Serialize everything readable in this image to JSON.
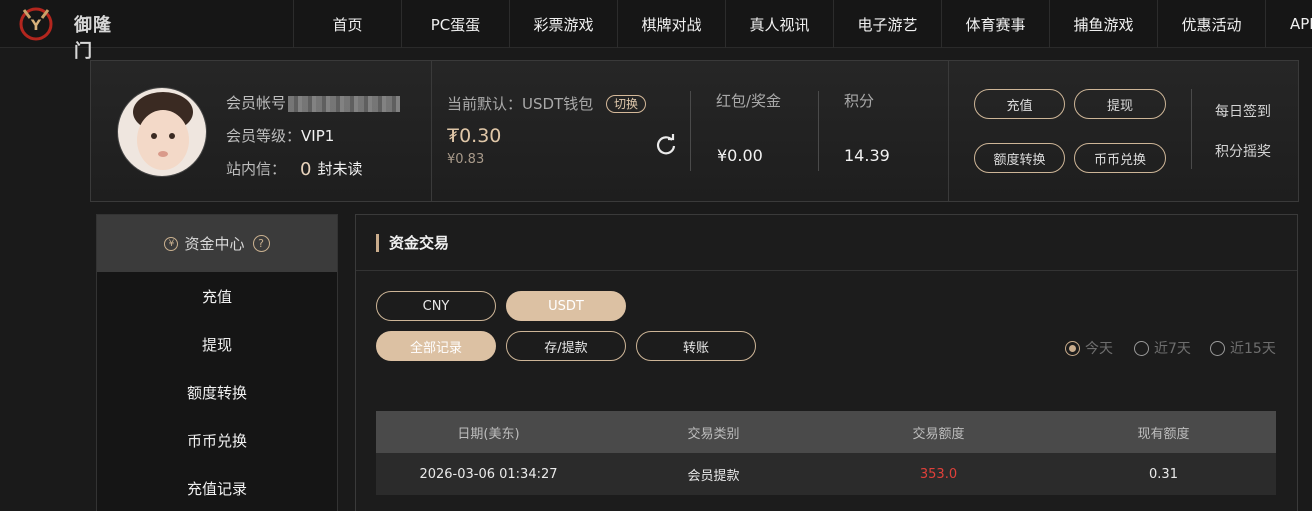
{
  "brand": {
    "name": "御隆门"
  },
  "nav": {
    "items": [
      "首页",
      "PC蛋蛋",
      "彩票游戏",
      "棋牌对战",
      "真人视讯",
      "电子游艺",
      "体育赛事",
      "捕鱼游戏",
      "优惠活动",
      "APP"
    ]
  },
  "member": {
    "account_label": "会员帐号",
    "level_label": "会员等级：",
    "level_value": "VIP1",
    "mail_label": "站内信：",
    "mail_count": "0",
    "mail_suffix": "封未读",
    "wallet_label": "当前默认：USDT钱包",
    "switch_label": "切换",
    "usdt_amount": "₮0.30",
    "cny_amount": "¥0.83",
    "bonus_label": "红包/奖金",
    "bonus_value": "¥0.00",
    "points_label": "积分",
    "points_value": "14.39",
    "actions": {
      "recharge": "充值",
      "withdraw": "提现",
      "transfer": "额度转换",
      "exchange": "币币兑换"
    },
    "links": {
      "checkin": "每日签到",
      "lottery": "积分摇奖"
    }
  },
  "sidebar": {
    "title": "资金中心",
    "items": [
      "充值",
      "提现",
      "额度转换",
      "币币兑换",
      "充值记录"
    ]
  },
  "main": {
    "title": "资金交易",
    "currency_tabs": [
      "CNY",
      "USDT"
    ],
    "type_tabs": [
      "全部记录",
      "存/提款",
      "转账"
    ],
    "ranges": [
      "今天",
      "近7天",
      "近15天"
    ],
    "table": {
      "headers": [
        "日期(美东)",
        "交易类别",
        "交易额度",
        "现有额度"
      ],
      "rows": [
        [
          "2026-03-06 01:34:27",
          "会员提款",
          "353.0",
          "0.31"
        ]
      ]
    }
  },
  "colors": {
    "accent": "#dcc1a3",
    "negative": "#e0403a"
  }
}
